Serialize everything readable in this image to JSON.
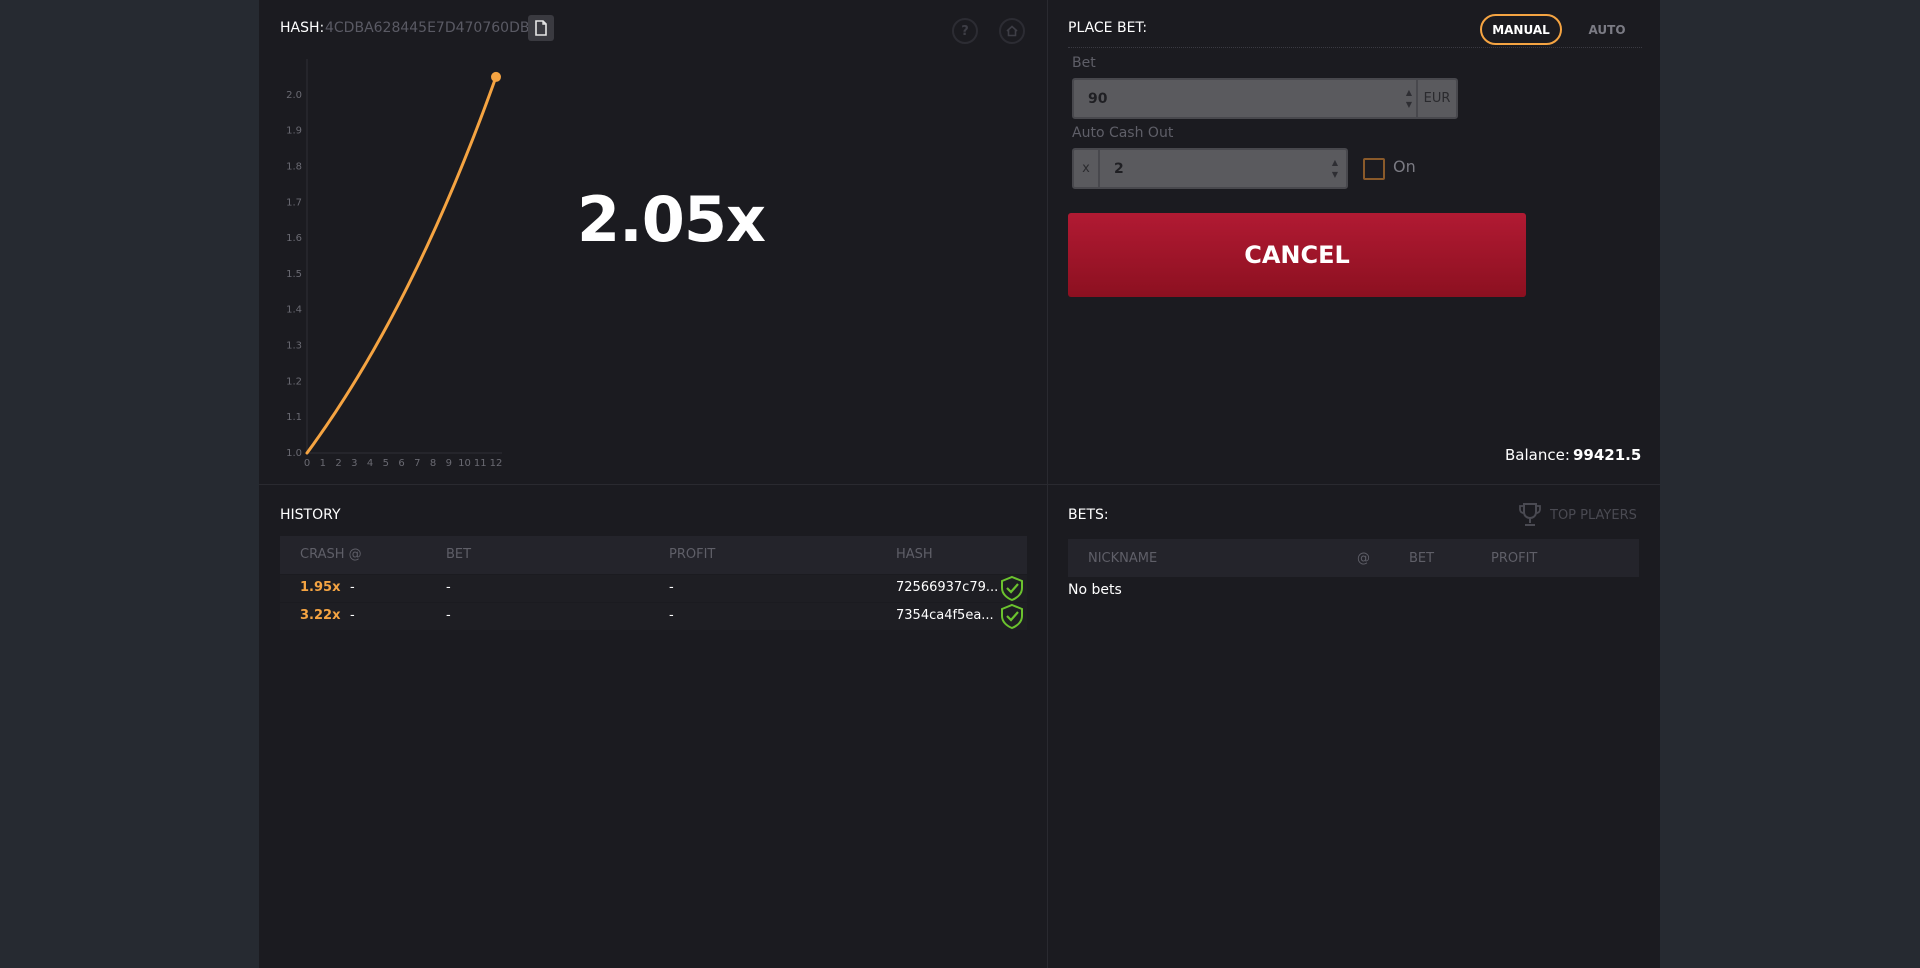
{
  "game": {
    "hash_label": "HASH:",
    "hash_value": "4CDBA628445E7D470760DB...",
    "multiplier": "2.05x",
    "help_label": "?",
    "chart": {
      "x_ticks": [
        "0",
        "1",
        "2",
        "3",
        "4",
        "5",
        "6",
        "7",
        "8",
        "9",
        "10",
        "11",
        "12"
      ],
      "y_ticks": [
        "1.0",
        "1.1",
        "1.2",
        "1.3",
        "1.4",
        "1.5",
        "1.6",
        "1.7",
        "1.8",
        "1.9",
        "2.0"
      ],
      "line_color": "#f5a442"
    }
  },
  "chart_data": {
    "type": "line",
    "title": "",
    "xlabel": "",
    "ylabel": "",
    "xlim": [
      0,
      12
    ],
    "ylim": [
      1.0,
      2.1
    ],
    "x": [
      0,
      2,
      4,
      6,
      8,
      10,
      12
    ],
    "series": [
      {
        "values": [
          1.0,
          1.13,
          1.27,
          1.43,
          1.61,
          1.82,
          2.05
        ]
      }
    ]
  },
  "place_bet": {
    "title": "PLACE BET:",
    "tabs": [
      {
        "label": "MANUAL",
        "active": true
      },
      {
        "label": "AUTO",
        "active": false
      }
    ],
    "bet_label": "Bet",
    "bet_value": "90",
    "currency": "EUR",
    "auto_cashout_label": "Auto Cash Out",
    "auto_cashout_prefix": "x",
    "auto_cashout_value": "2",
    "auto_cashout_toggle_label": "On",
    "auto_cashout_checked": false,
    "cancel_label": "CANCEL",
    "balance_label": "Balance:",
    "balance_value": "99421.5"
  },
  "history": {
    "title": "HISTORY",
    "columns": [
      "CRASH @",
      "BET",
      "PROFIT",
      "HASH"
    ],
    "rows": [
      {
        "crash": "1.95x",
        "crash_dash": "-",
        "bet": "-",
        "profit": "-",
        "hash": "72566937c79..."
      },
      {
        "crash": "3.22x",
        "crash_dash": "-",
        "bet": "-",
        "profit": "-",
        "hash": "7354ca4f5ea..."
      }
    ]
  },
  "bets": {
    "title": "BETS:",
    "top_players_label": "TOP PLAYERS",
    "columns": [
      "NICKNAME",
      "@",
      "BET",
      "PROFIT"
    ],
    "empty_text": "No bets"
  },
  "colors": {
    "accent": "#f5a442",
    "cancel": "#a0162b",
    "verified": "#6bc22e"
  }
}
